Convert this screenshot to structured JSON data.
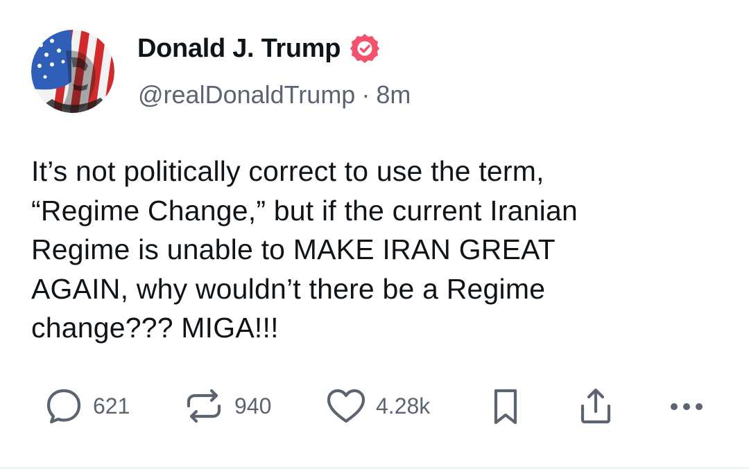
{
  "author": {
    "display_name": "Donald J. Trump",
    "handle": "@realDonaldTrump",
    "timestamp": "8m",
    "separator": "·",
    "avatar_icon": "avatar-flag-portrait",
    "verified_icon": "verified-badge-icon",
    "verified_color": "#f4516c"
  },
  "post": {
    "text": "It’s not politically correct to use the term,\n“Regime Change,” but if the current Iranian\nRegime is unable to MAKE IRAN GREAT\nAGAIN, why wouldn’t there be a Regime\nchange??? MIGA!!!"
  },
  "actions": {
    "replies": {
      "icon": "reply-bubble-icon",
      "count": "621"
    },
    "reposts": {
      "icon": "repost-arrows-icon",
      "count": "940"
    },
    "likes": {
      "icon": "heart-icon",
      "count": "4.28k"
    },
    "bookmark": {
      "icon": "bookmark-icon"
    },
    "share": {
      "icon": "share-upload-icon"
    },
    "more": {
      "icon": "more-dots-icon"
    }
  },
  "colors": {
    "text_primary": "#0f1419",
    "text_secondary": "#5b6470",
    "icon_gray": "#5b6470"
  }
}
